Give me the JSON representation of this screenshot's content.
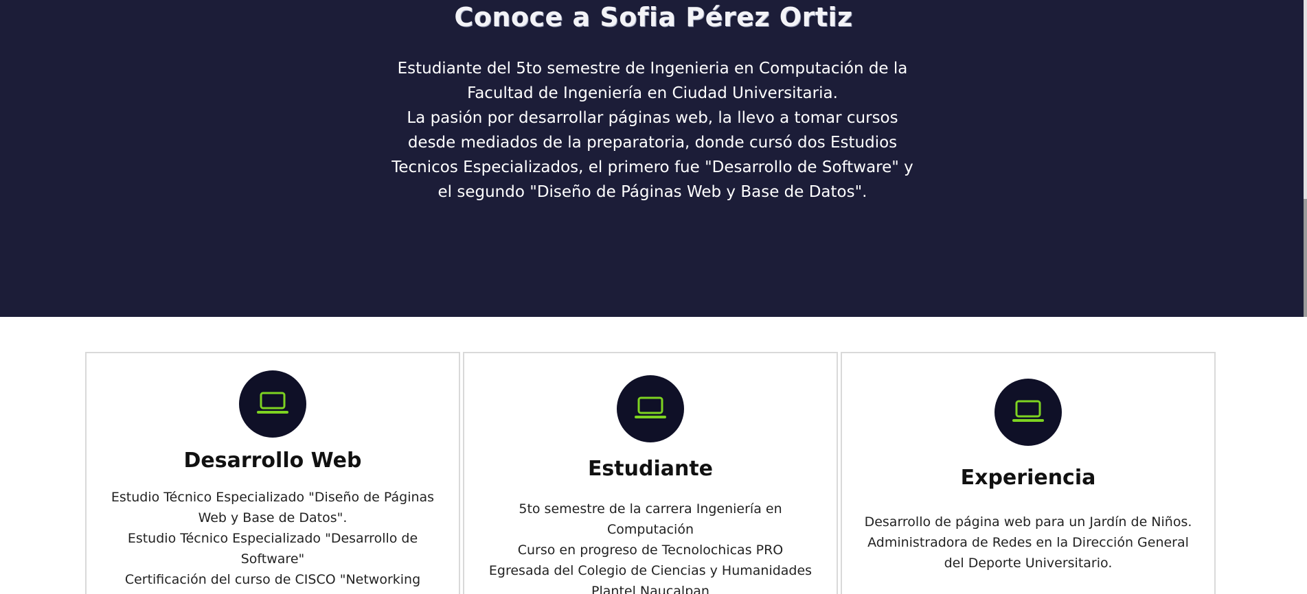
{
  "hero": {
    "title": "Conoce a Sofia Pérez Ortiz",
    "lines": [
      "Estudiante del 5to semestre de Ingenieria en Computación de la Facultad de Ingeniería en Ciudad Universitaria.",
      "La pasión por desarrollar páginas web, la llevo a tomar cursos desde mediados de la preparatoria, donde cursó dos Estudios Tecnicos Especializados, el primero fue \"Desarrollo de Software\" y el segundo \"Diseño de Páginas Web y Base de Datos\"."
    ]
  },
  "cards": [
    {
      "icon": "laptop-icon",
      "title": "Desarrollo Web",
      "lines": [
        "Estudio Técnico Especializado \"Diseño de Páginas Web y Base de Datos\".",
        "Estudio Técnico Especializado \"Desarrollo de Software\"",
        "Certificación del curso de CISCO \"Networking Essentials\""
      ]
    },
    {
      "icon": "laptop-icon",
      "title": "Estudiante",
      "lines": [
        "5to semestre de la carrera Ingeniería en Computación",
        "Curso en progreso de Tecnolochicas PRO",
        "Egresada del Colegio de Ciencias y Humanidades Plantel Naucalpan"
      ]
    },
    {
      "icon": "laptop-icon",
      "title": "Experiencia",
      "lines": [
        "Desarrollo de página web para un Jardín de Niños.",
        "Administradora de Redes en la Dirección General del Deporte Universitario."
      ]
    }
  ],
  "colors": {
    "hero_bg": "#1c1d38",
    "icon_circle": "#0f1027",
    "icon_accent": "#7ed321"
  }
}
